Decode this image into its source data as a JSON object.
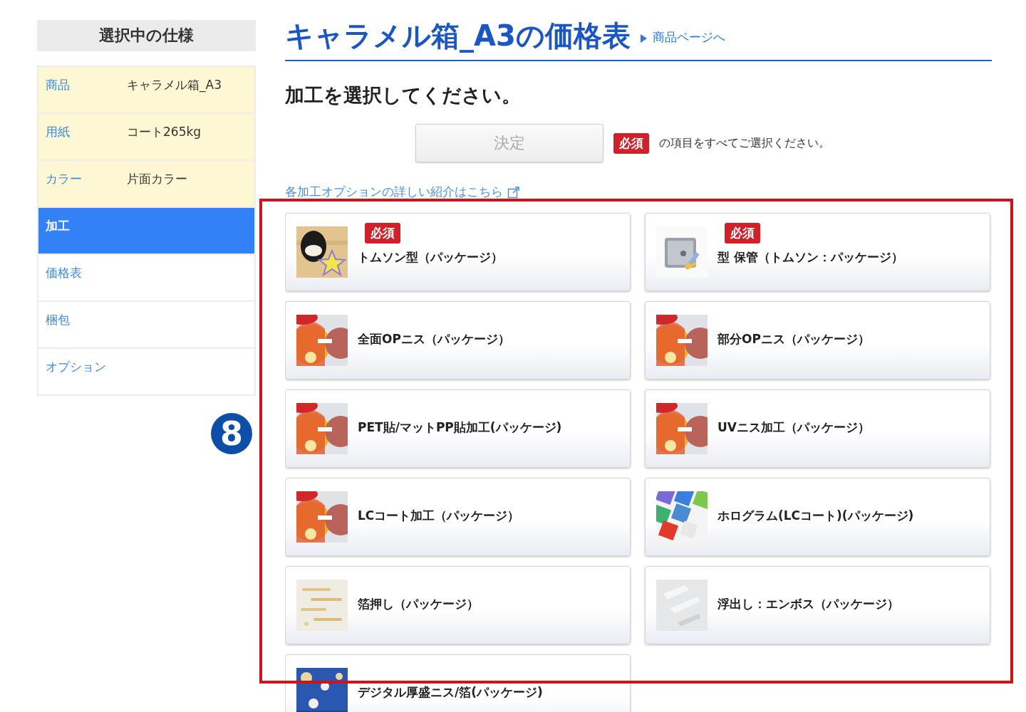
{
  "sidebar": {
    "title": "選択中の仕様",
    "items": [
      {
        "label": "商品",
        "value": "キャラメル箱_A3",
        "completed": true,
        "selected": false
      },
      {
        "label": "用紙",
        "value": "コート265kg",
        "completed": true,
        "selected": false
      },
      {
        "label": "カラー",
        "value": "片面カラー",
        "completed": true,
        "selected": false
      },
      {
        "label": "加工",
        "completed": false,
        "selected": true
      },
      {
        "label": "価格表",
        "completed": false,
        "selected": false
      },
      {
        "label": "梱包",
        "completed": false,
        "selected": false
      },
      {
        "label": "オプション",
        "completed": false,
        "selected": false
      }
    ]
  },
  "page": {
    "title": "キャラメル箱_A3の価格表",
    "product_link": "商品ページへ"
  },
  "prompt": "加工を選択してください。",
  "confirm": {
    "label": "決定",
    "disabled": true,
    "required_badge": "必須",
    "note": "の項目をすべてご選択ください。"
  },
  "details_link": "各加工オプションの詳しい紹介はこちら",
  "options": [
    {
      "name": "トムソン型（パッケージ）",
      "required": true,
      "badge": "必須"
    },
    {
      "name": "型 保管（トムソン：パッケージ）",
      "required": true,
      "badge": "必須"
    },
    {
      "name": "全面OPニス（パッケージ）",
      "required": false
    },
    {
      "name": "部分OPニス（パッケージ）",
      "required": false
    },
    {
      "name": "PET貼/マットPP貼加工(パッケージ)",
      "required": false
    },
    {
      "name": "UVニス加工（パッケージ）",
      "required": false
    },
    {
      "name": "LCコート加工（パッケージ）",
      "required": false
    },
    {
      "name": "ホログラム(LCコート)(パッケージ)",
      "required": false
    },
    {
      "name": "箔押し（パッケージ）",
      "required": false
    },
    {
      "name": "浮出し：エンボス（パッケージ）",
      "required": false
    },
    {
      "name": "デジタル厚盛ニス/箔(パッケージ)",
      "required": false
    }
  ],
  "annotation": {
    "number": "8"
  }
}
